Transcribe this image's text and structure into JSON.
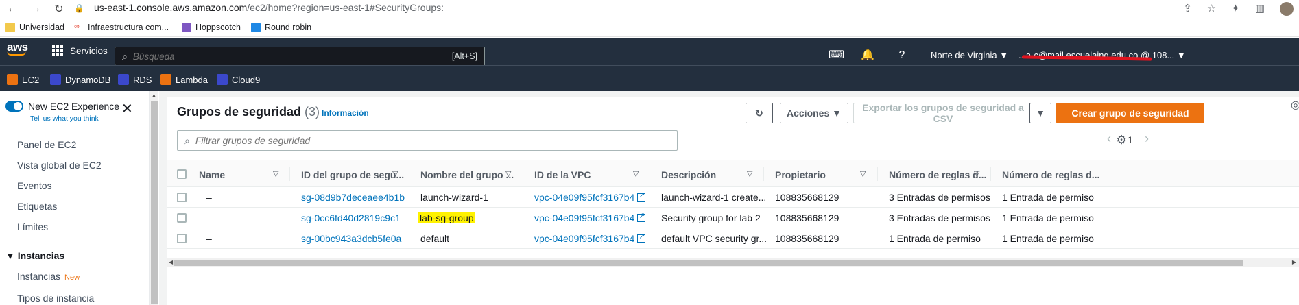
{
  "browser": {
    "url_host": "us-east-1.console.aws.amazon.com",
    "url_path": "/ec2/home?region=us-east-1#SecurityGroups:",
    "bookmarks": [
      "Universidad",
      "Infraestructura com...",
      "Hoppscotch",
      "Round robin"
    ]
  },
  "aws_nav": {
    "logo": "aws",
    "services_label": "Servicios",
    "search_placeholder": "Búsqueda",
    "search_shortcut": "[Alt+S]",
    "region": "Norte de Virginia ▼",
    "account": "...a-c@mail.escuelaing.edu.co @ 108... ▼"
  },
  "favorites": [
    "EC2",
    "DynamoDB",
    "RDS",
    "Lambda",
    "Cloud9"
  ],
  "sidebar": {
    "new_experience": "New EC2 Experience",
    "tell_us": "Tell us what you think",
    "items": [
      "Panel de EC2",
      "Vista global de EC2",
      "Eventos",
      "Etiquetas",
      "Límites"
    ],
    "section_instances": "Instancias",
    "sub_items": [
      "Instancias",
      "Tipos de instancia"
    ],
    "new_badge": "New"
  },
  "main": {
    "title": "Grupos de seguridad",
    "count": "(3)",
    "info": "Información",
    "actions_label": "Acciones ▼",
    "export_label": "Exportar los grupos de seguridad a CSV",
    "create_label": "Crear grupo de seguridad",
    "filter_placeholder": "Filtrar grupos de seguridad",
    "page": "1"
  },
  "table": {
    "columns": [
      "Name",
      "ID del grupo de segu...",
      "Nombre del grupo ...",
      "ID de la VPC",
      "Descripción",
      "Propietario",
      "Número de reglas d...",
      "Número de reglas d..."
    ],
    "rows": [
      {
        "name": "–",
        "group_id": "sg-08d9b7deceaee4b1b",
        "group_name": "launch-wizard-1",
        "vpc": "vpc-04e09f95fcf3167b4",
        "description": "launch-wizard-1 create...",
        "owner": "108835668129",
        "inbound": "3 Entradas de permisos",
        "outbound": "1 Entrada de permiso"
      },
      {
        "name": "–",
        "group_id": "sg-0cc6fd40d2819c9c1",
        "group_name": "lab-sg-group",
        "vpc": "vpc-04e09f95fcf3167b4",
        "description": "Security group for lab 2",
        "owner": "108835668129",
        "inbound": "3 Entradas de permisos",
        "outbound": "1 Entrada de permiso"
      },
      {
        "name": "–",
        "group_id": "sg-00bc943a3dcb5fe0a",
        "group_name": "default",
        "vpc": "vpc-04e09f95fcf3167b4",
        "description": "default VPC security gr...",
        "owner": "108835668129",
        "inbound": "1 Entrada de permiso",
        "outbound": "1 Entrada de permiso"
      }
    ]
  },
  "colors": {
    "aws_nav": "#232f3e",
    "primary_button": "#ec7211",
    "link": "#0073bb",
    "highlight": "#fff200"
  }
}
